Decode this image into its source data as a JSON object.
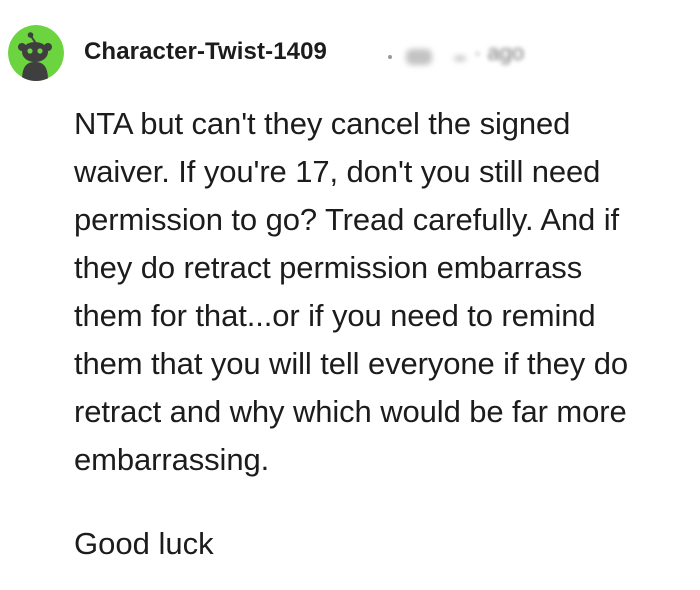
{
  "comment": {
    "author": "Character-Twist-1409",
    "timestamp": "· ago",
    "avatar_icon": "snoo-avatar-icon",
    "avatar_color": "#6cd43f",
    "body_lines": [
      "NTA but can't they cancel the signed",
      "waiver. If you're 17, don't you still need",
      "permission to go? Tread carefully. And if",
      "they do retract permission embarrass",
      "them for that...or if you need to remind",
      "them that you will tell everyone if they do",
      "retract and why which would be far more",
      "embarrassing."
    ],
    "closing": "Good luck"
  }
}
